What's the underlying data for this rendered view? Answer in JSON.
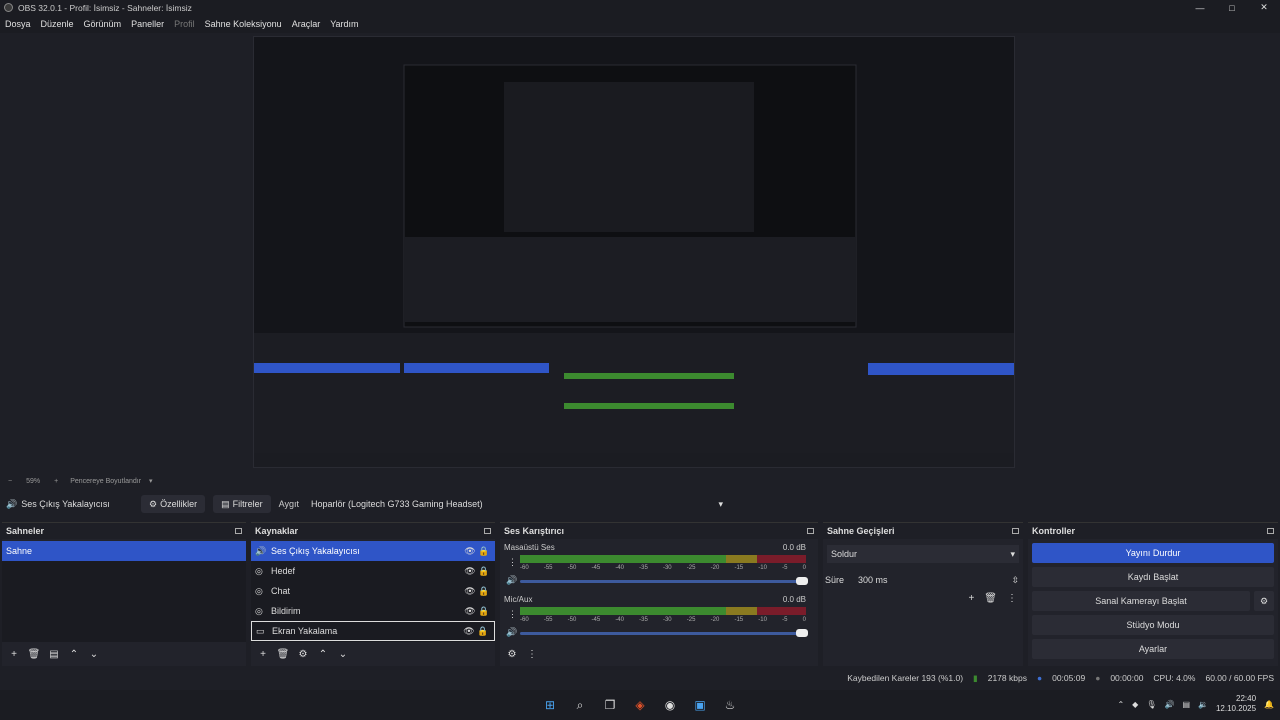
{
  "window": {
    "title": "OBS 32.0.1 - Profil: İsimsiz - Sahneler: İsimsiz",
    "min": "—",
    "max": "□",
    "close": "✕"
  },
  "menu": [
    "Dosya",
    "Düzenle",
    "Görünüm",
    "Paneller",
    "Profil",
    "Sahne Koleksiyonu",
    "Araçlar",
    "Yardım"
  ],
  "zoom": {
    "minus": "−",
    "value": "59%",
    "plus": "+",
    "mode": "Pencereye Boyutlandır"
  },
  "source_toolbar": {
    "selected": "Ses Çıkış Yakalayıcısı",
    "properties": "Özellikler",
    "filters": "Filtreler",
    "device_label": "Aygıt",
    "device_value": "Hoparlör (Logitech G733 Gaming Headset)"
  },
  "scenes": {
    "title": "Sahneler",
    "items": [
      "Sahne"
    ]
  },
  "sources": {
    "title": "Kaynaklar",
    "items": [
      {
        "name": "Ses Çıkış Yakalayıcısı",
        "icon": "speaker-icon"
      },
      {
        "name": "Hedef",
        "icon": "globe-icon"
      },
      {
        "name": "Chat",
        "icon": "globe-icon"
      },
      {
        "name": "Bildirim",
        "icon": "globe-icon"
      },
      {
        "name": "Ekran Yakalama",
        "icon": "monitor-icon"
      }
    ]
  },
  "mixer": {
    "title": "Ses Karıştırıcı",
    "channels": [
      {
        "name": "Masaüstü Ses",
        "db": "0.0 dB"
      },
      {
        "name": "Mic/Aux",
        "db": "0.0 dB"
      }
    ],
    "ticks": [
      "-60",
      "-55",
      "-50",
      "-45",
      "-40",
      "-35",
      "-30",
      "-25",
      "-20",
      "-15",
      "-10",
      "-5",
      "0"
    ]
  },
  "transitions": {
    "title": "Sahne Geçişleri",
    "type": "Soldur",
    "duration_label": "Süre",
    "duration": "300 ms"
  },
  "controls": {
    "title": "Kontroller",
    "stream": "Yayını Durdur",
    "record": "Kaydı Başlat",
    "vcam": "Sanal Kamerayı Başlat",
    "studio": "Stüdyo Modu",
    "settings": "Ayarlar"
  },
  "status": {
    "dropped": "Kaybedilen Kareler 193 (%1.0)",
    "bitrate": "2178 kbps",
    "stream_time": "00:05:09",
    "rec_time": "00:00:00",
    "cpu": "CPU: 4.0%",
    "fps": "60.00 / 60.00 FPS"
  },
  "clock": {
    "time": "22:40",
    "date": "12.10.2025"
  }
}
